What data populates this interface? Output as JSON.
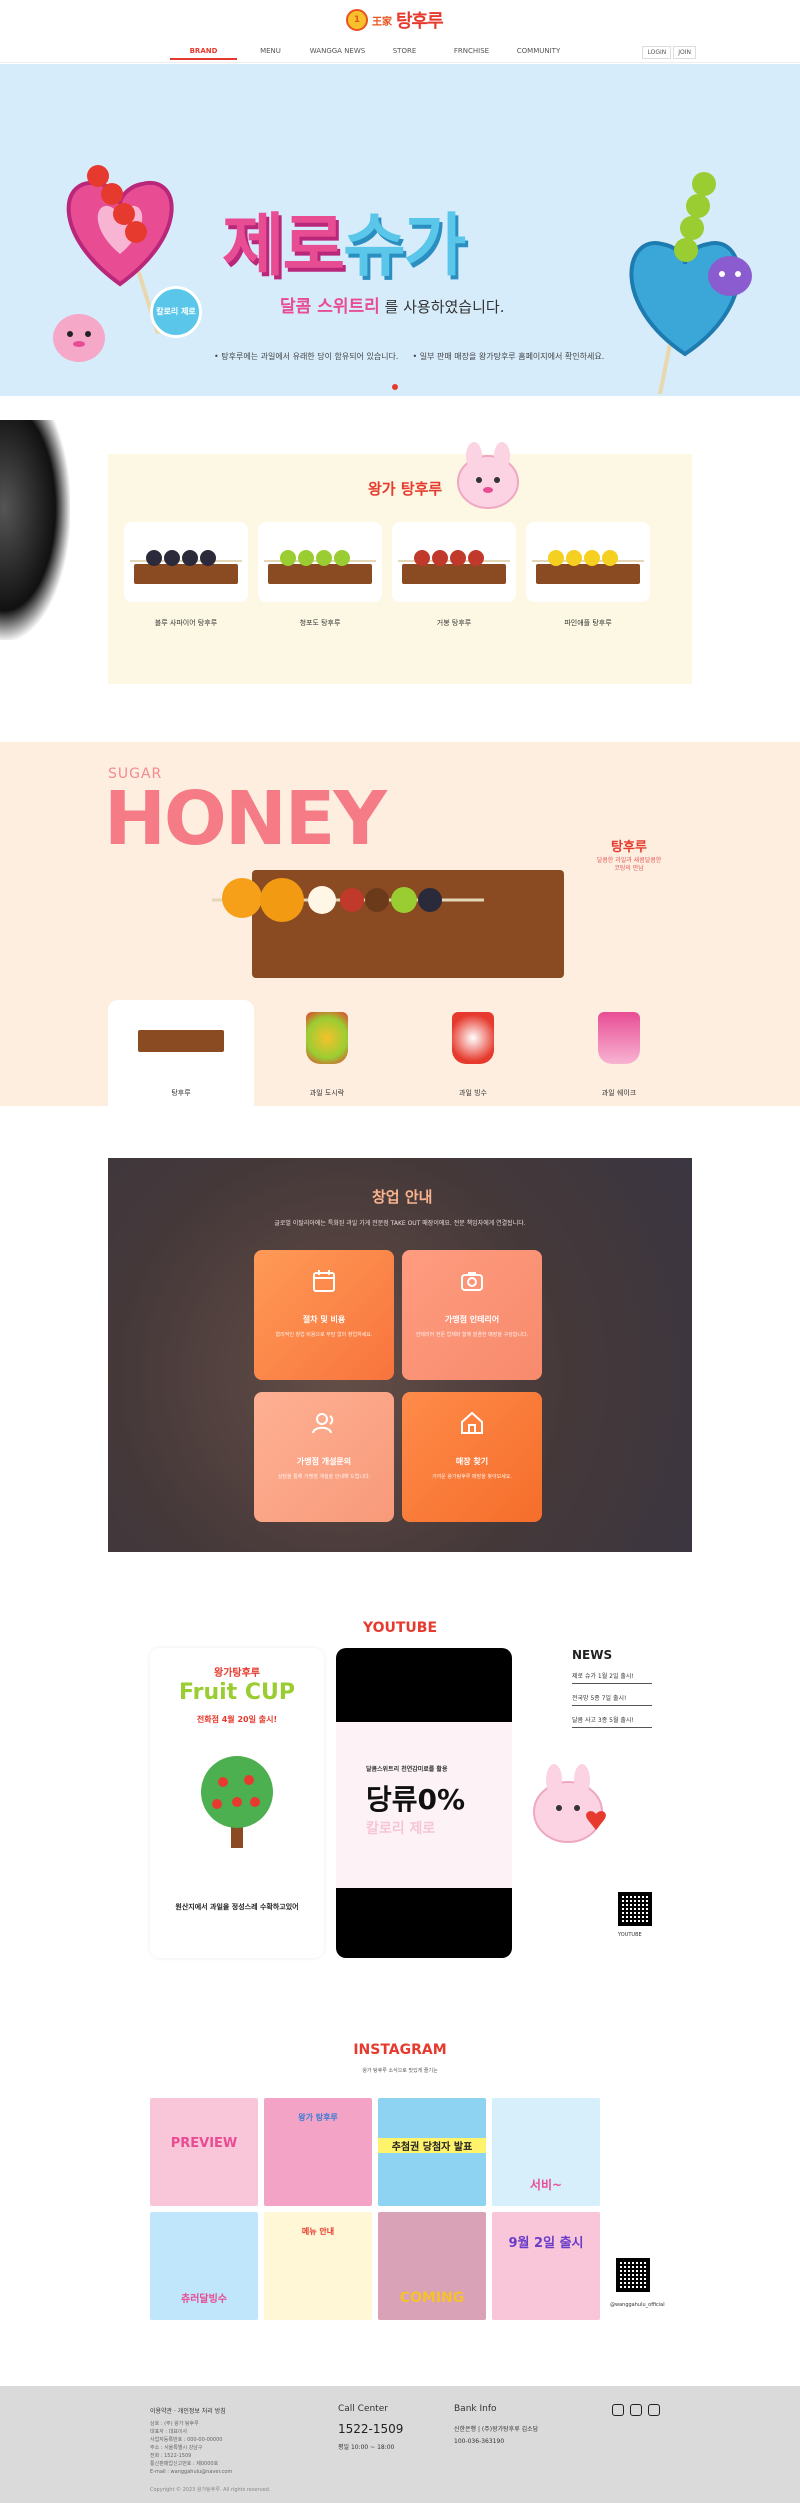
{
  "header": {
    "logo_badge": "1",
    "logo_sub": "王家",
    "logo_text": "탕후루",
    "nav": [
      "BRAND",
      "MENU",
      "WANGGA NEWS",
      "STORE",
      "FRNCHISE",
      "COMMUNITY"
    ],
    "login": "LOGIN",
    "join": "JOIN"
  },
  "hero": {
    "title_part1": "제로",
    "title_part2": "슈가",
    "sub_highlight": "달콤 스위트리",
    "sub_rest": " 를 사용하였습니다.",
    "note1": "• 탕후루에는 과일에서 유래한 당이 함유되어 있습니다.",
    "note2": "• 일부 판매 매장을 왕가탕후루 홈페이지에서 확인하세요.",
    "sticker": "칼로리 제로"
  },
  "products": {
    "title": "왕가 탕후루",
    "items": [
      {
        "label": "블루 사파이어 탕후루",
        "color": "#2a2a3a"
      },
      {
        "label": "청포도 탕후루",
        "color": "#9acd32"
      },
      {
        "label": "거봉 탕후루",
        "color": "#c0392b"
      },
      {
        "label": "파인애플 탕후루",
        "color": "#f5d020"
      }
    ]
  },
  "honey": {
    "sugar": "SUGAR",
    "title": "HONEY",
    "right_title": "탕후루",
    "right_desc": "달콤한 과일과 새콤달콤한 코팅의 만남",
    "tabs": [
      "탕후루",
      "과일 도시락",
      "과일 빙수",
      "과일 쉐이크"
    ]
  },
  "startup": {
    "title": "창업 안내",
    "subtitle": "글로벌 이탈리아에는 특화된 과일 가게 전문점 TAKE OUT 매장이에요. 전문 책임자에게 연결됩니다.",
    "cards": [
      {
        "title": "절차 및 비용",
        "desc": "합리적인 창업 비용으로\n부담 없이 창업하세요.",
        "icon": "calendar-icon"
      },
      {
        "title": "가맹점 인테리어",
        "desc": "인테리어 전문 업체와 함께\n깔끔한 매장을 구성합니다.",
        "icon": "camera-icon"
      },
      {
        "title": "가맹점 개설문의",
        "desc": "상담을 통해 가맹점 개설을\n안내해 드립니다.",
        "icon": "user-icon"
      },
      {
        "title": "매장 찾기",
        "desc": "가까운 왕가탕후루 매장을\n찾아보세요.",
        "icon": "home-icon"
      }
    ]
  },
  "youtube": {
    "title": "YOUTUBE",
    "card1_brand": "왕가탕후루",
    "card1_title": "Fruit CUP",
    "card1_date": "전화점 4월 20일 출시!",
    "card1_caption": "원산지에서 과일을 정성스레 수확하고있어",
    "card2_top": "달콤스위트리 천연감미료를 활용",
    "card2_main": "당류0%",
    "card2_sub": "칼로리 제로",
    "news_title": "NEWS",
    "news": [
      "제로 슈가 1월 2일 출시!",
      "전국망 5종 7일 출시!",
      "달콤 사고 3종 5월 출시!"
    ],
    "qr_label": "YOUTUBE"
  },
  "instagram": {
    "title": "INSTAGRAM",
    "sub": "왕가 탕후루 소식으로\n맛있게 즐기는",
    "tiles": [
      "PREVIEW",
      "왕가 탕후루",
      "추첨권 당첨자 발표",
      "서비~",
      "츄러달빙수",
      "메뉴 안내",
      "COMING",
      "9월 2일 출시"
    ],
    "handle": "@wanggahulu_official"
  },
  "footer": {
    "links": "이용약관 · 개인정보 처리 방침",
    "info": "상호 : (주) 왕가 탕후루\n대표자 : 대표이사\n사업자등록번호 : 000-00-00000\n주소 : 서울특별시 강남구\n전화 : 1522-1509\n통신판매업신고번호 : 제0000호\nE-mail : wanggahulu@naver.com",
    "copy": "Copyright © 2023 왕가탕후루. All rights reserved.",
    "call_title": "Call Center",
    "call_number": "1522-1509",
    "call_hours": "평일 10:00 ~ 18:00",
    "bank_title": "Bank Info",
    "bank_name": "신한은행 | (주)왕가탕후루 김소담",
    "bank_account": "100-036-363190"
  }
}
